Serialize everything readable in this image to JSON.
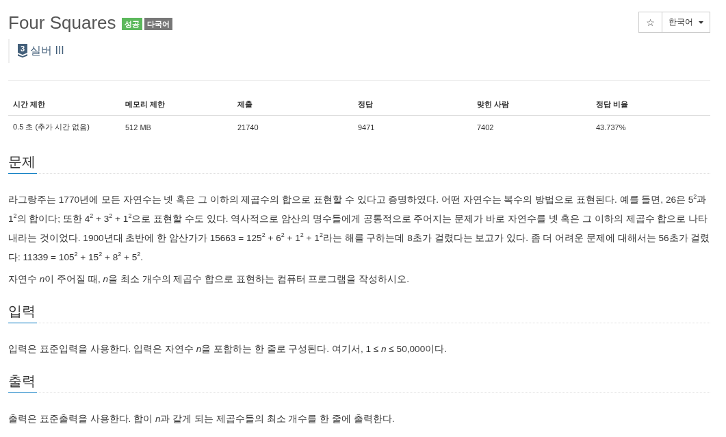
{
  "problem": {
    "title": "Four Squares",
    "badges": [
      {
        "label": "성공",
        "color": "#5cb85c"
      },
      {
        "label": "다국어",
        "color": "#777777"
      }
    ],
    "tier": {
      "rank": "3",
      "label": "실버 III"
    }
  },
  "toolbar": {
    "star_button": "☆",
    "language_select": "한국어"
  },
  "stats": {
    "columns": [
      "시간 제한",
      "메모리 제한",
      "제출",
      "정답",
      "맞힌 사람",
      "정답 비율"
    ],
    "rows": [
      [
        "0.5 초 (추가 시간 없음)",
        "512 MB",
        "21740",
        "9471",
        "7402",
        "43.737%"
      ]
    ]
  },
  "sections": [
    {
      "heading": "문제",
      "paragraphs": [
        [
          {
            "kind": "text",
            "text": "라그랑주는 1770년에 모든 자연수는 넷 혹은 그 이하의 제곱수의 합으로 표현할 수 있다고 증명하였다. 어떤 자연수는 복수의 방법으로 표현된다. 예를 들면, 26은 5$^{2}$과 1$^{2}$의 합이다; 또한 4$^{2}$ + 3$^{2}$ + 1$^{2}$으로 표현할 수도 있다. 역사적으로 암산의 명수들에게 공통적으로 주어지는 문제가 바로 자연수를 넷 혹은 그 이하의 제곱수 합으로 나타내라는 것이었다. 1900년대 초반에 한 암산가가 15663 = 125$^{2}$ + 6$^{2}$ + 1$^{2}$ + 1$^{2}$라는 해를 구하는데 8초가 걸렸다는 보고가 있다. 좀 더 어려운 문제에 대해서는 56초가 걸렸다: 11339 = 105$^{2}$ + 15$^{2}$ + 8$^{2}$ + 5$^{2}$."
          }
        ],
        [
          {
            "kind": "text",
            "text": "자연수 "
          },
          {
            "kind": "variable",
            "text": "n"
          },
          {
            "kind": "text",
            "text": "이 주어질 때, "
          },
          {
            "kind": "variable",
            "text": "n"
          },
          {
            "kind": "text",
            "text": "을 최소 개수의 제곱수 합으로 표현하는 컴퓨터 프로그램을 작성하시오."
          }
        ]
      ]
    },
    {
      "heading": "입력",
      "paragraphs": [
        [
          {
            "kind": "text",
            "text": "입력은 표준입력을 사용한다. 입력은 자연수 "
          },
          {
            "kind": "variable",
            "text": "n"
          },
          {
            "kind": "text",
            "text": "을 포함하는 한 줄로 구성된다. 여기서, 1 ≤ "
          },
          {
            "kind": "variable",
            "text": "n"
          },
          {
            "kind": "text",
            "text": " ≤ 50,000이다."
          }
        ]
      ]
    },
    {
      "heading": "출력",
      "paragraphs": [
        [
          {
            "kind": "text",
            "text": "출력은 표준출력을 사용한다. 합이 "
          },
          {
            "kind": "variable",
            "text": "n"
          },
          {
            "kind": "text",
            "text": "과 같게 되는 제곱수들의 최소 개수를 한 줄에 출력한다."
          }
        ]
      ]
    }
  ]
}
